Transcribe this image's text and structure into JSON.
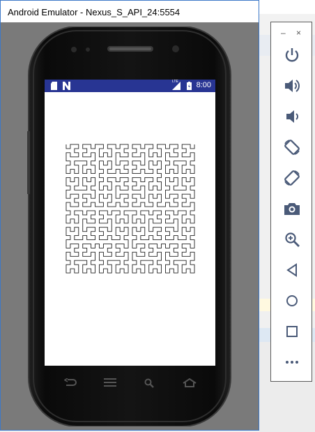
{
  "window": {
    "title": "Android Emulator - Nexus_S_API_24:5554"
  },
  "statusbar": {
    "time": "8:00",
    "network_label": "LTE"
  },
  "toolbar": {
    "minimize_glyph": "–",
    "close_glyph": "×",
    "buttons": [
      {
        "name": "power-icon"
      },
      {
        "name": "volume-up-icon"
      },
      {
        "name": "volume-down-icon"
      },
      {
        "name": "rotate-left-icon"
      },
      {
        "name": "rotate-right-icon"
      },
      {
        "name": "camera-icon"
      },
      {
        "name": "zoom-icon"
      },
      {
        "name": "back-icon"
      },
      {
        "name": "home-icon"
      },
      {
        "name": "overview-icon"
      },
      {
        "name": "more-icon"
      }
    ]
  },
  "colors": {
    "statusbar": "#283593",
    "window_border": "#3c78c8",
    "toolbar_icons": "#4a5a78",
    "fractal_stroke": "#222222"
  }
}
